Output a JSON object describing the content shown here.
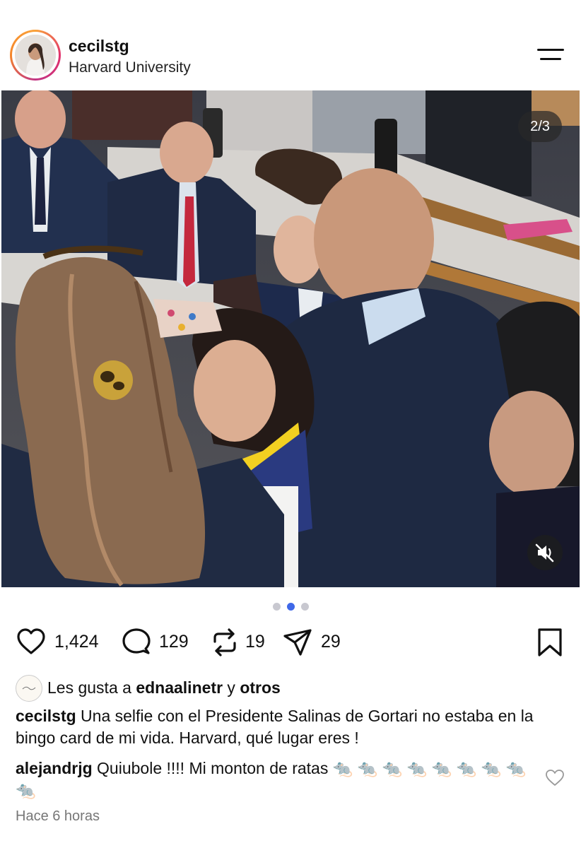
{
  "post": {
    "username": "cecilstg",
    "location": "Harvard University",
    "image_counter": "2/3",
    "carousel_dots": 3,
    "carousel_active_index": 1
  },
  "actions": {
    "likes_count": "1,424",
    "comments_count": "129",
    "reposts_count": "19",
    "shares_count": "29"
  },
  "liked_by": {
    "prefix": "Les gusta a ",
    "user": "ednaalinetr",
    "connector": " y ",
    "others": "otros"
  },
  "caption": {
    "username": "cecilstg",
    "text": "Una selfie con el Presidente Salinas de Gortari no estaba en la bingo card de mi vida. Harvard, qué lugar eres !"
  },
  "comment": {
    "username": "alejandrjg",
    "text": "Quiubole !!!! Mi monton de ratas 🐀 🐀 🐀 🐀 🐀 🐀 🐀 🐀 🐀"
  },
  "timestamp": "Hace 6 horas",
  "icons": {
    "menu": "menu-icon",
    "like": "heart-icon",
    "comment": "comment-bubble-icon",
    "repost": "repost-icon",
    "share": "send-icon",
    "save": "bookmark-icon",
    "mute": "speaker-muted-icon"
  },
  "colors": {
    "active_dot": "#3f68e8",
    "inactive_dot": "#c8c8d0",
    "timestamp": "#777777",
    "story_ring": [
      "#f9a23a",
      "#e1306c",
      "#c13584"
    ]
  }
}
